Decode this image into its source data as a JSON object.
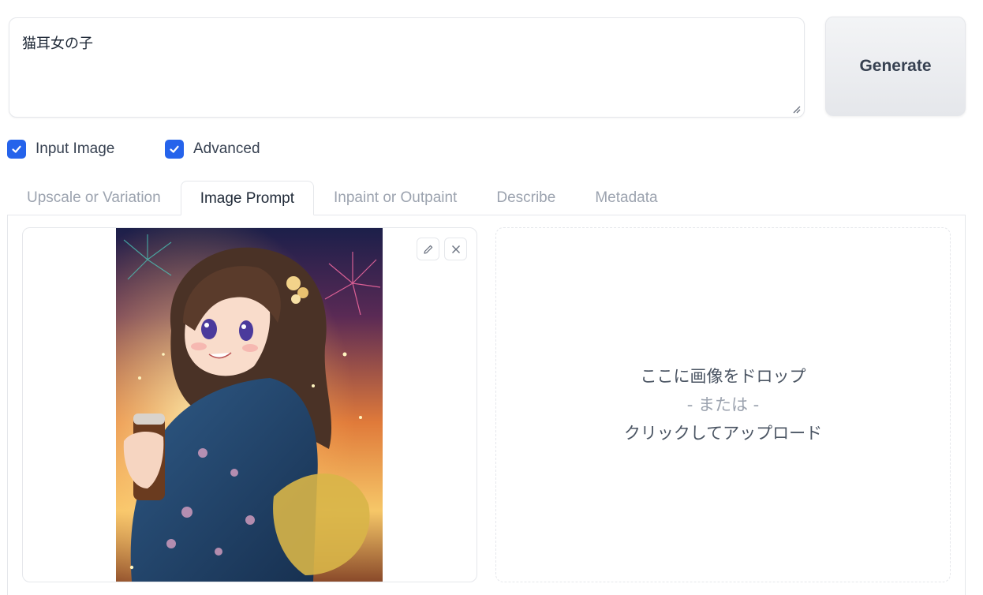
{
  "prompt": {
    "value": "猫耳女の子"
  },
  "generate_button": {
    "label": "Generate"
  },
  "options": [
    {
      "label": "Input Image",
      "checked": true
    },
    {
      "label": "Advanced",
      "checked": true
    }
  ],
  "tabs": [
    {
      "label": "Upscale or Variation",
      "active": false
    },
    {
      "label": "Image Prompt",
      "active": true
    },
    {
      "label": "Inpaint or Outpaint",
      "active": false
    },
    {
      "label": "Describe",
      "active": false
    },
    {
      "label": "Metadata",
      "active": false
    }
  ],
  "image_panel": {
    "edit_icon": "pencil-icon",
    "clear_icon": "close-icon"
  },
  "drop_zone": {
    "line1": "ここに画像をドロップ",
    "line2": "- または -",
    "line3": "クリックしてアップロード"
  },
  "colors": {
    "accent": "#2563eb",
    "border": "#e5e7eb",
    "muted_text": "#9ca3af"
  }
}
